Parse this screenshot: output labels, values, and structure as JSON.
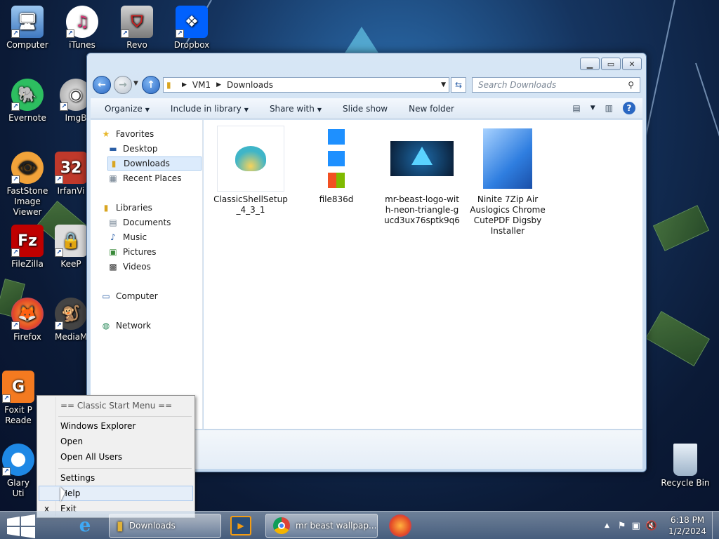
{
  "desktop": {
    "icons": [
      {
        "label": "Computer"
      },
      {
        "label": "iTunes"
      },
      {
        "label": "Revo"
      },
      {
        "label": "Dropbox"
      },
      {
        "label": "Evernote"
      },
      {
        "label": "ImgB"
      },
      {
        "label": "FastStone Image Viewer"
      },
      {
        "label": "IrfanVi"
      },
      {
        "label": "FileZilla"
      },
      {
        "label": "KeeP"
      },
      {
        "label": "Firefox"
      },
      {
        "label": "MediaM"
      },
      {
        "label": "Foxit P Reade"
      },
      {
        "label": "Glary Uti"
      },
      {
        "label": "Recycle Bin"
      }
    ]
  },
  "explorer": {
    "breadcrumb": [
      "VM1",
      "Downloads"
    ],
    "search_placeholder": "Search Downloads",
    "toolbar": {
      "organize": "Organize",
      "include": "Include in library",
      "share": "Share with",
      "slideshow": "Slide show",
      "newfolder": "New folder"
    },
    "nav": {
      "favorites": "Favorites",
      "desktop": "Desktop",
      "downloads": "Downloads",
      "recent": "Recent Places",
      "libraries": "Libraries",
      "documents": "Documents",
      "music": "Music",
      "pictures": "Pictures",
      "videos": "Videos",
      "computer": "Computer",
      "network": "Network"
    },
    "files": [
      {
        "name": "ClassicShellSetup_4_3_1"
      },
      {
        "name": "file836d"
      },
      {
        "name": "mr-beast-logo-with-neon-triangle-gucd3ux76sptk9q6"
      },
      {
        "name": "Ninite 7Zip Air Auslogics Chrome CutePDF Digsby Installer"
      }
    ]
  },
  "context_menu": {
    "header": "== Classic Start Menu ==",
    "items": [
      "Windows Explorer",
      "Open",
      "Open All Users",
      "Settings",
      "Help",
      "Exit"
    ],
    "exit_mark": "x"
  },
  "taskbar": {
    "downloads_label": "Downloads",
    "chrome_label": "mr beast wallpap...",
    "time": "6:18 PM",
    "date": "1/2/2024"
  },
  "colors": {
    "accent": "#2a67c2",
    "selection": "#dcebfc"
  }
}
